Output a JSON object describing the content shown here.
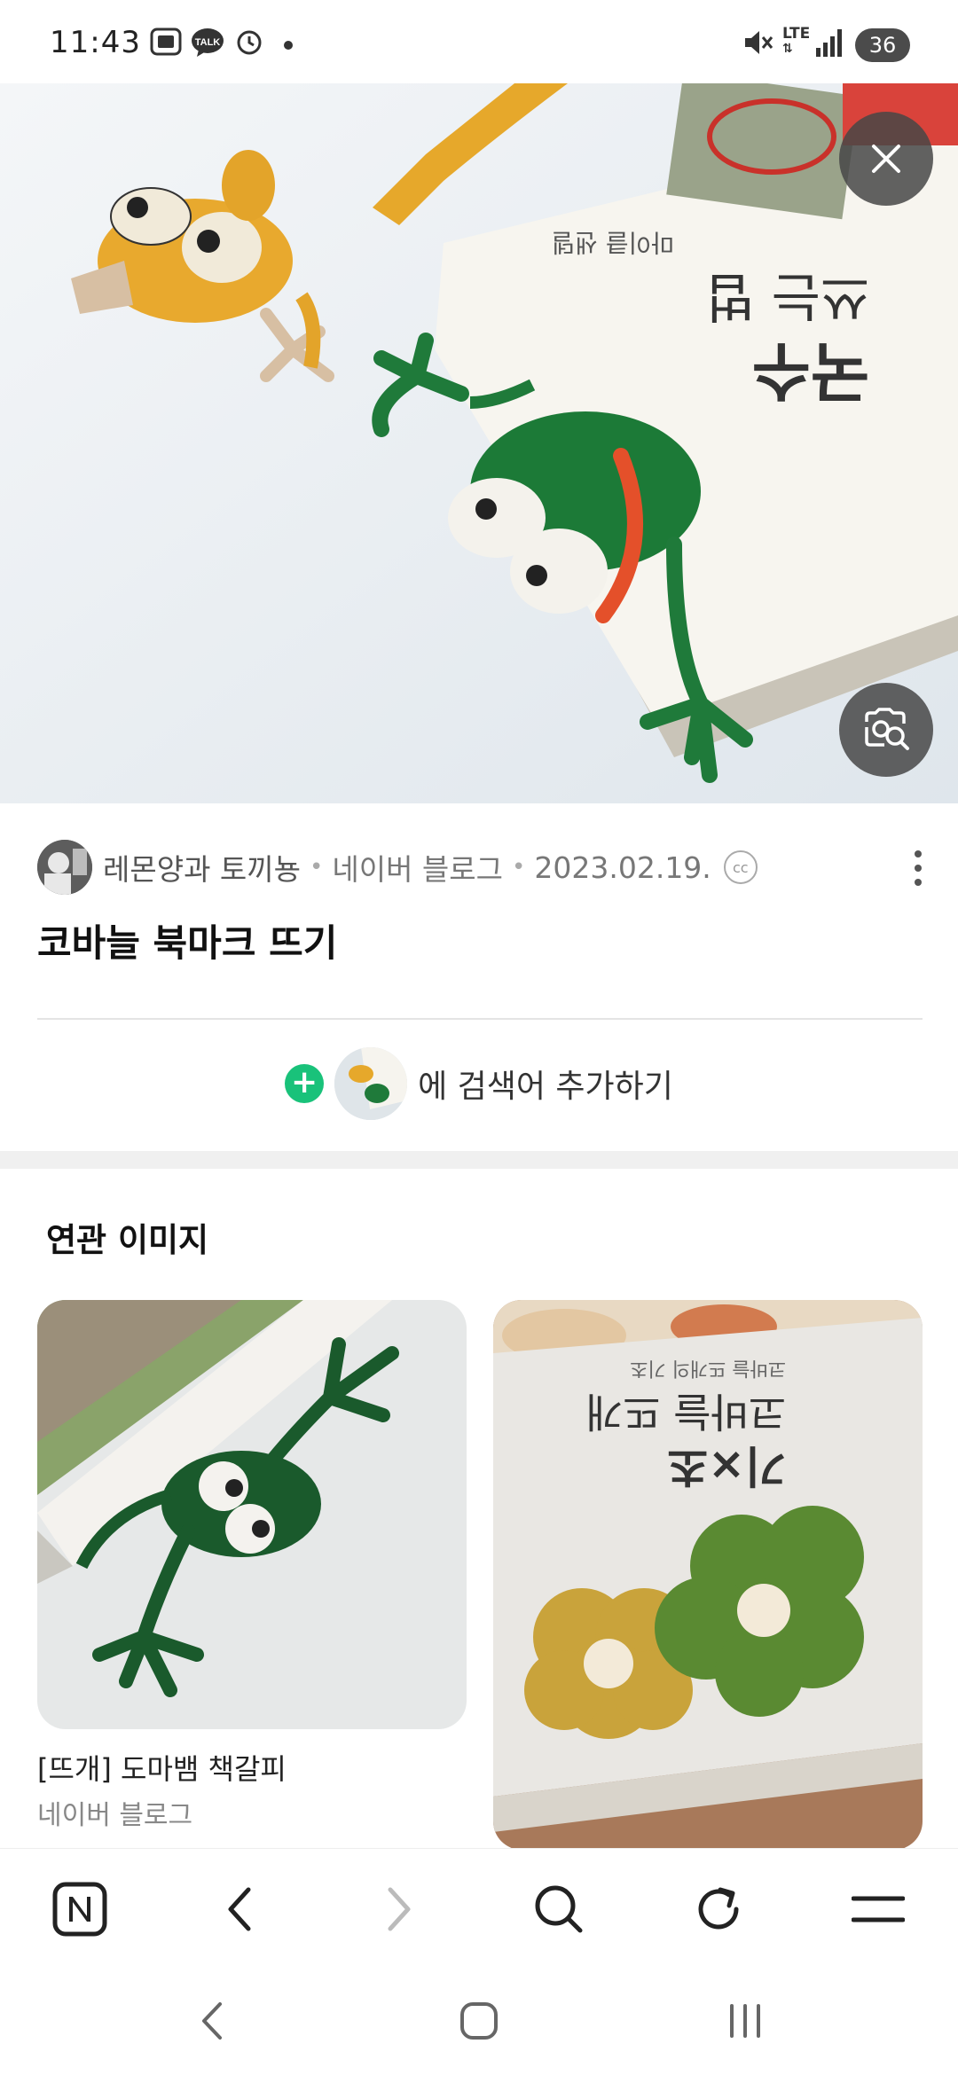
{
  "status_bar": {
    "time": "11:43",
    "network": "LTE",
    "battery": "36",
    "icons": [
      "screenshot-icon",
      "talk-icon",
      "alarm-icon",
      "dot-icon",
      "mute-icon",
      "lte-icon",
      "signal-icon",
      "battery-icon"
    ]
  },
  "hero": {
    "icons": [
      "close-icon",
      "lens-search-icon"
    ]
  },
  "result": {
    "author": "레몬양과 토끼뇽",
    "source": "네이버 블로그",
    "date": "2023.02.19.",
    "license_badge": "cc",
    "title": "코바늘 북마크 뜨기"
  },
  "add_query": {
    "text": "에 검색어 추가하기"
  },
  "related": {
    "section_title": "연관 이미지",
    "items": [
      {
        "caption": "[뜨개] 도마뱀 책갈피",
        "source": "네이버 블로그"
      },
      {
        "caption": "",
        "source": ""
      }
    ]
  },
  "toolbar": {
    "icons": [
      "naver-home-icon",
      "back-icon",
      "forward-icon",
      "search-icon",
      "refresh-icon",
      "menu-icon"
    ]
  },
  "navbar": {
    "icons": [
      "nav-back-icon",
      "nav-home-icon",
      "nav-recents-icon"
    ]
  },
  "colors": {
    "accent_green": "#19c27a",
    "overlay_button": "#464646"
  }
}
